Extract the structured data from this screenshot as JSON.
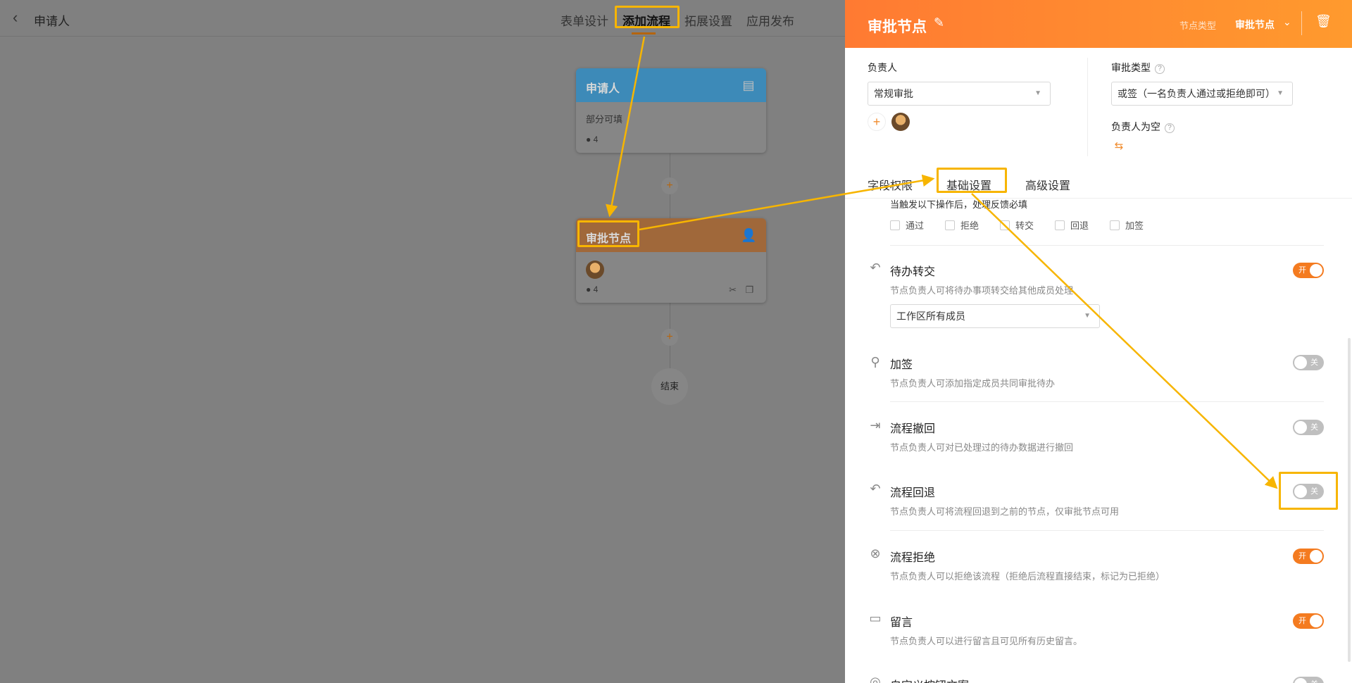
{
  "topbar": {
    "back_icon": "chevron-left-icon",
    "title": "申请人",
    "tabs": [
      {
        "label": "表单设计"
      },
      {
        "label": "添加流程"
      },
      {
        "label": "拓展设置"
      },
      {
        "label": "应用发布"
      }
    ]
  },
  "canvas": {
    "applicant_node": {
      "title": "申请人",
      "subtitle": "部分可填",
      "count": "4",
      "color": "#2f8fd6"
    },
    "approval_node": {
      "title": "审批节点",
      "count": "4",
      "color": "#e8822a"
    },
    "end_label": "结束",
    "plus": "+"
  },
  "panel": {
    "title": "审批节点",
    "node_type_label": "节点类型",
    "node_type_value": "审批节点",
    "assignee_label": "负责人",
    "assignee_select": "常规审批",
    "approval_type_label": "审批类型",
    "approval_type_select": "或签（一名负责人通过或拒绝即可）",
    "empty_assignee_label": "负责人为空",
    "tabs": [
      {
        "label": "字段权限"
      },
      {
        "label": "基础设置"
      },
      {
        "label": "高级设置"
      }
    ],
    "trigger_text": "当触发以下操作后，处理反馈必填",
    "checkboxes": [
      {
        "label": "通过"
      },
      {
        "label": "拒绝"
      },
      {
        "label": "转交"
      },
      {
        "label": "回退"
      },
      {
        "label": "加签"
      }
    ],
    "settings": [
      {
        "title": "待办转交",
        "desc": "节点负责人可将待办事项转交给其他成员处理",
        "state": "开",
        "icon": "reply-icon"
      },
      {
        "title": "加签",
        "desc": "节点负责人可添加指定成员共同审批待办",
        "state": "关",
        "icon": "user-add-icon"
      },
      {
        "title": "流程撤回",
        "desc": "节点负责人可对已处理过的待办数据进行撤回",
        "state": "关",
        "icon": "withdraw-icon"
      },
      {
        "title": "流程回退",
        "desc": "节点负责人可将流程回退到之前的节点，仅审批节点可用",
        "state": "关",
        "icon": "rollback-icon"
      },
      {
        "title": "流程拒绝",
        "desc": "节点负责人可以拒绝该流程（拒绝后流程直接结束，标记为已拒绝）",
        "state": "开",
        "icon": "reject-icon"
      },
      {
        "title": "留言",
        "desc": "节点负责人可以进行留言且可见所有历史留言。",
        "state": "开",
        "icon": "comment-icon"
      },
      {
        "title": "自定义按钮文案",
        "state": "关",
        "icon": "custom-icon"
      }
    ],
    "transfer_scope_select": "工作区所有成员"
  },
  "colors": {
    "accent": "#f47b20",
    "highlight": "#f7b500"
  }
}
